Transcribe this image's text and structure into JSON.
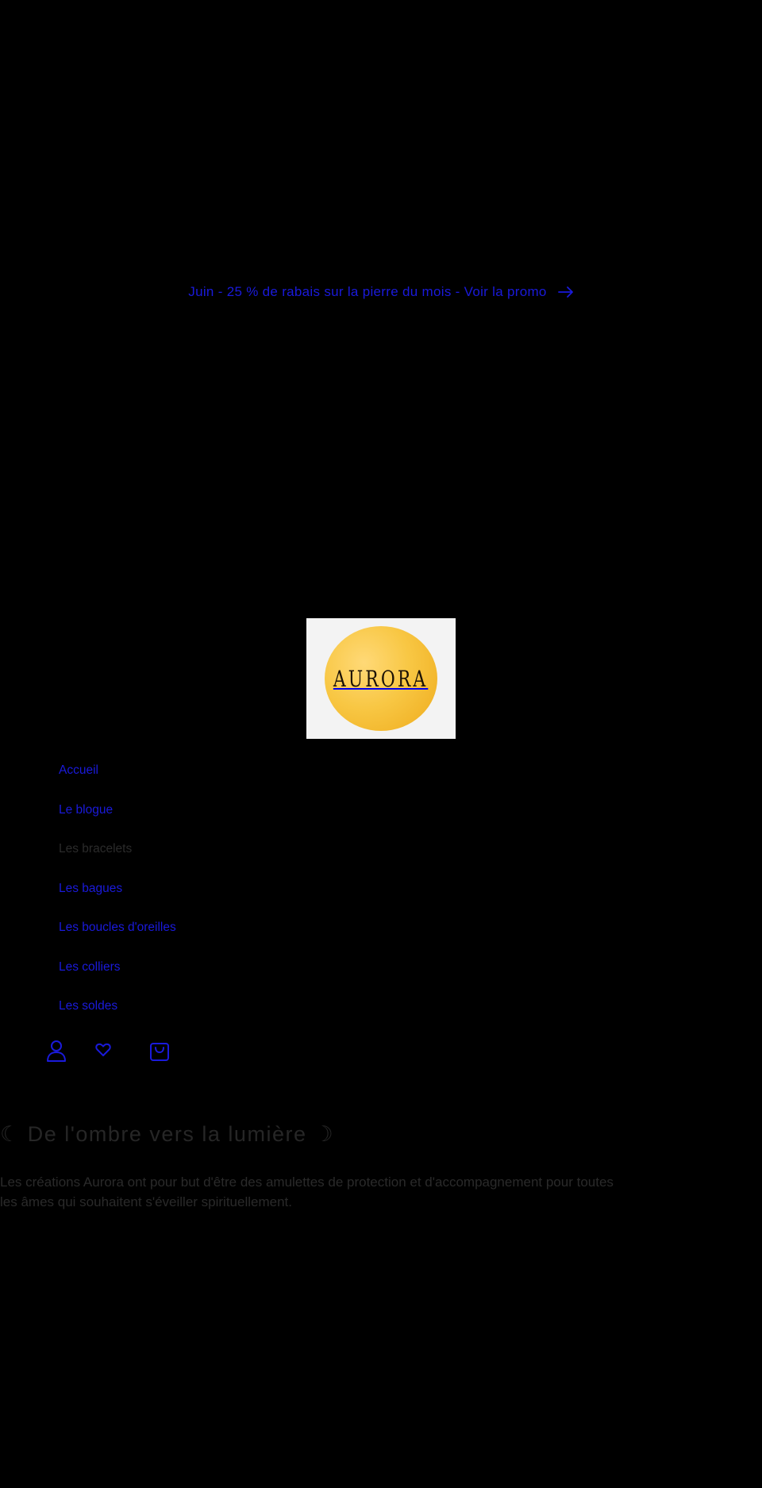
{
  "announcement": {
    "text": "Juin - 25 % de rabais sur la pierre du mois - Voir la promo",
    "arrow_icon": "arrow-right-icon"
  },
  "logo": {
    "text": "AURORA"
  },
  "nav": {
    "items": [
      {
        "label": "Accueil"
      },
      {
        "label": "Le blogue"
      },
      {
        "label": "Les bracelets"
      },
      {
        "label": "Les bagues"
      },
      {
        "label": "Les boucles d'oreilles"
      },
      {
        "label": "Les colliers"
      },
      {
        "label": "Les soldes"
      }
    ]
  },
  "header_icons": [
    "account-icon",
    "wishlist-heart-icon",
    "cart-bag-icon"
  ],
  "hero": {
    "title": "☾ De l'ombre vers la lumière ☽",
    "text": "Les créations Aurora ont pour but d'être des amulettes de protection et d'accompagnement pour toutes les âmes qui souhaitent s'éveiller spirituellement."
  },
  "colors": {
    "background": "#000000",
    "link": "#1a1adb",
    "text": "#2a2a2a",
    "logo_gold": "#f8c744"
  }
}
